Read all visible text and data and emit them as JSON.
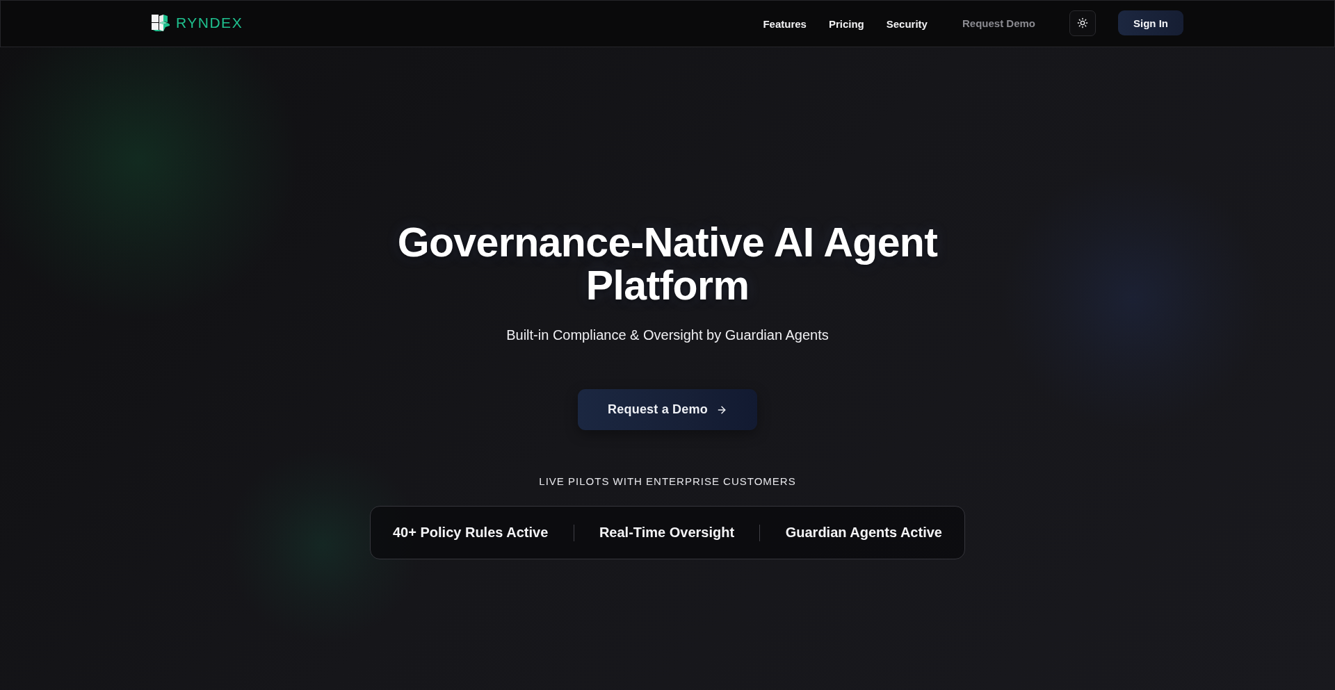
{
  "header": {
    "brand": "RYNDEX",
    "nav_links": [
      "Features",
      "Pricing",
      "Security"
    ],
    "request_demo_link": "Request Demo",
    "sign_in_button": "Sign In"
  },
  "hero": {
    "title": "Governance-Native AI Agent Platform",
    "subtitle": "Built-in Compliance & Oversight by Guardian Agents",
    "cta_button": "Request a Demo",
    "pilots_label": "LIVE PILOTS WITH ENTERPRISE CUSTOMERS",
    "stats": [
      "40+ Policy Rules Active",
      "Real-Time Oversight",
      "Guardian Agents Active"
    ]
  }
}
